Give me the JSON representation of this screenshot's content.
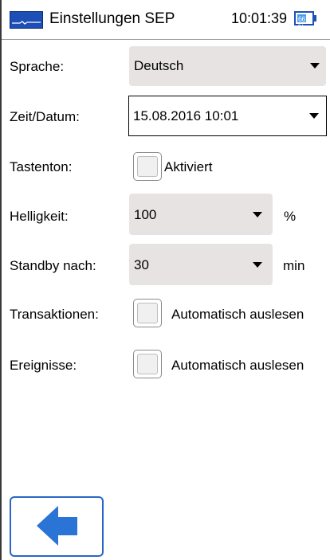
{
  "header": {
    "title": "Einstellungen SEP",
    "time": "10:01:39",
    "battery_text": "66 %",
    "battery_level": 0.66,
    "icon": "app-logo-icon"
  },
  "settings": {
    "language": {
      "label": "Sprache:",
      "value": "Deutsch"
    },
    "datetime": {
      "label": "Zeit/Datum:",
      "value": "15.08.2016 10:01"
    },
    "key_tone": {
      "label": "Tastenton:",
      "checkbox_label": "Aktiviert",
      "checked": false
    },
    "brightness": {
      "label": "Helligkeit:",
      "value": "100",
      "unit": "%"
    },
    "standby": {
      "label": "Standby nach:",
      "value": "30",
      "unit": "min"
    },
    "transactions": {
      "label": "Transaktionen:",
      "checkbox_label": "Automatisch auslesen",
      "checked": false
    },
    "events": {
      "label": "Ereignisse:",
      "checkbox_label": "Automatisch auslesen",
      "checked": false
    }
  },
  "footer": {
    "back_icon": "arrow-left-icon"
  },
  "colors": {
    "accent": "#1d4fb6",
    "arrow": "#2a74d6",
    "select_bg": "#e7e3e3"
  }
}
